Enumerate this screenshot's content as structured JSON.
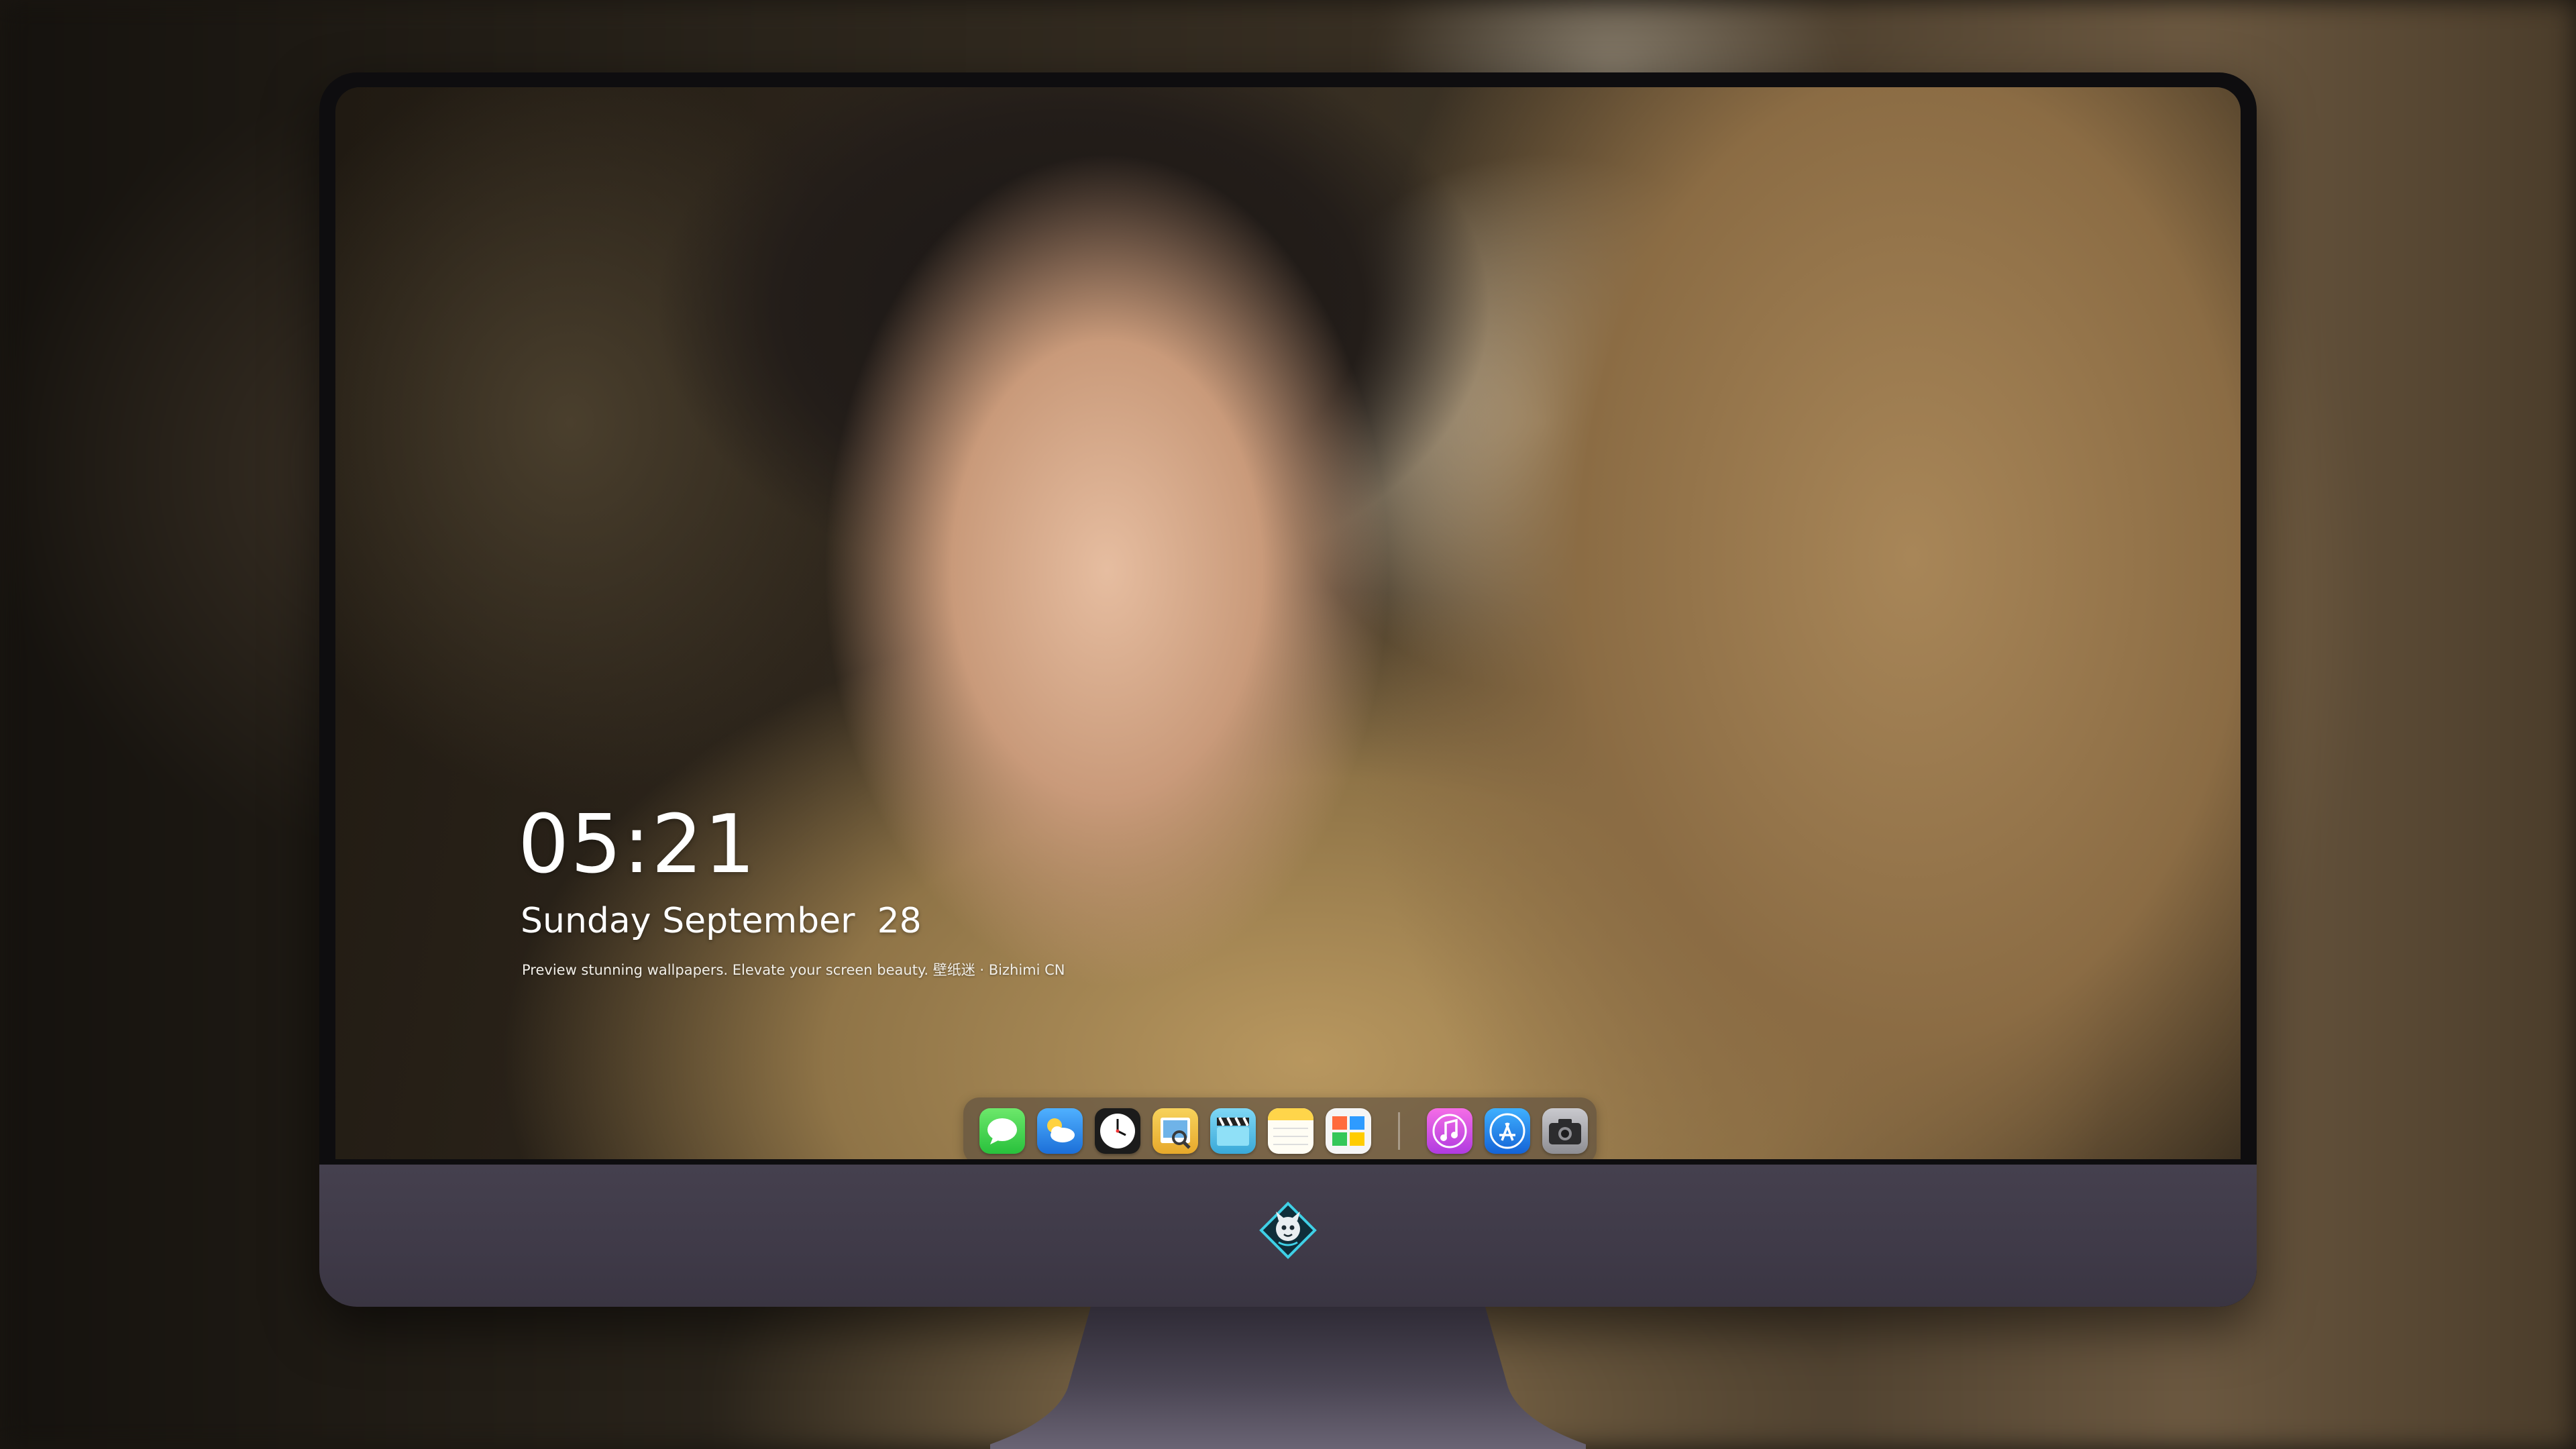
{
  "lockscreen": {
    "time": "05:21",
    "date": "Sunday September  28",
    "tagline": "Preview stunning wallpapers. Elevate your screen beauty. 壁纸迷 · Bizhimi CN"
  },
  "dock": {
    "apps": [
      {
        "name": "messages-icon",
        "color": "#3fd34f"
      },
      {
        "name": "weather-icon",
        "color": "#2f8ff0"
      },
      {
        "name": "clock-icon",
        "color": "#ffffff"
      },
      {
        "name": "preview-icon",
        "color": "#f4c542"
      },
      {
        "name": "clapperboard-icon",
        "color": "#4fc3e8"
      },
      {
        "name": "notes-icon",
        "color": "#ffd54a"
      },
      {
        "name": "photos-icon",
        "color": "#ff9f0a"
      },
      {
        "name": "music-icon",
        "color": "#e54cd6"
      },
      {
        "name": "app-store-icon",
        "color": "#1f8ef1"
      },
      {
        "name": "camera-icon",
        "color": "#8e8e93"
      }
    ]
  },
  "colors": {
    "monitor_chin": "#403b49",
    "bezel": "#0e0d0f"
  }
}
